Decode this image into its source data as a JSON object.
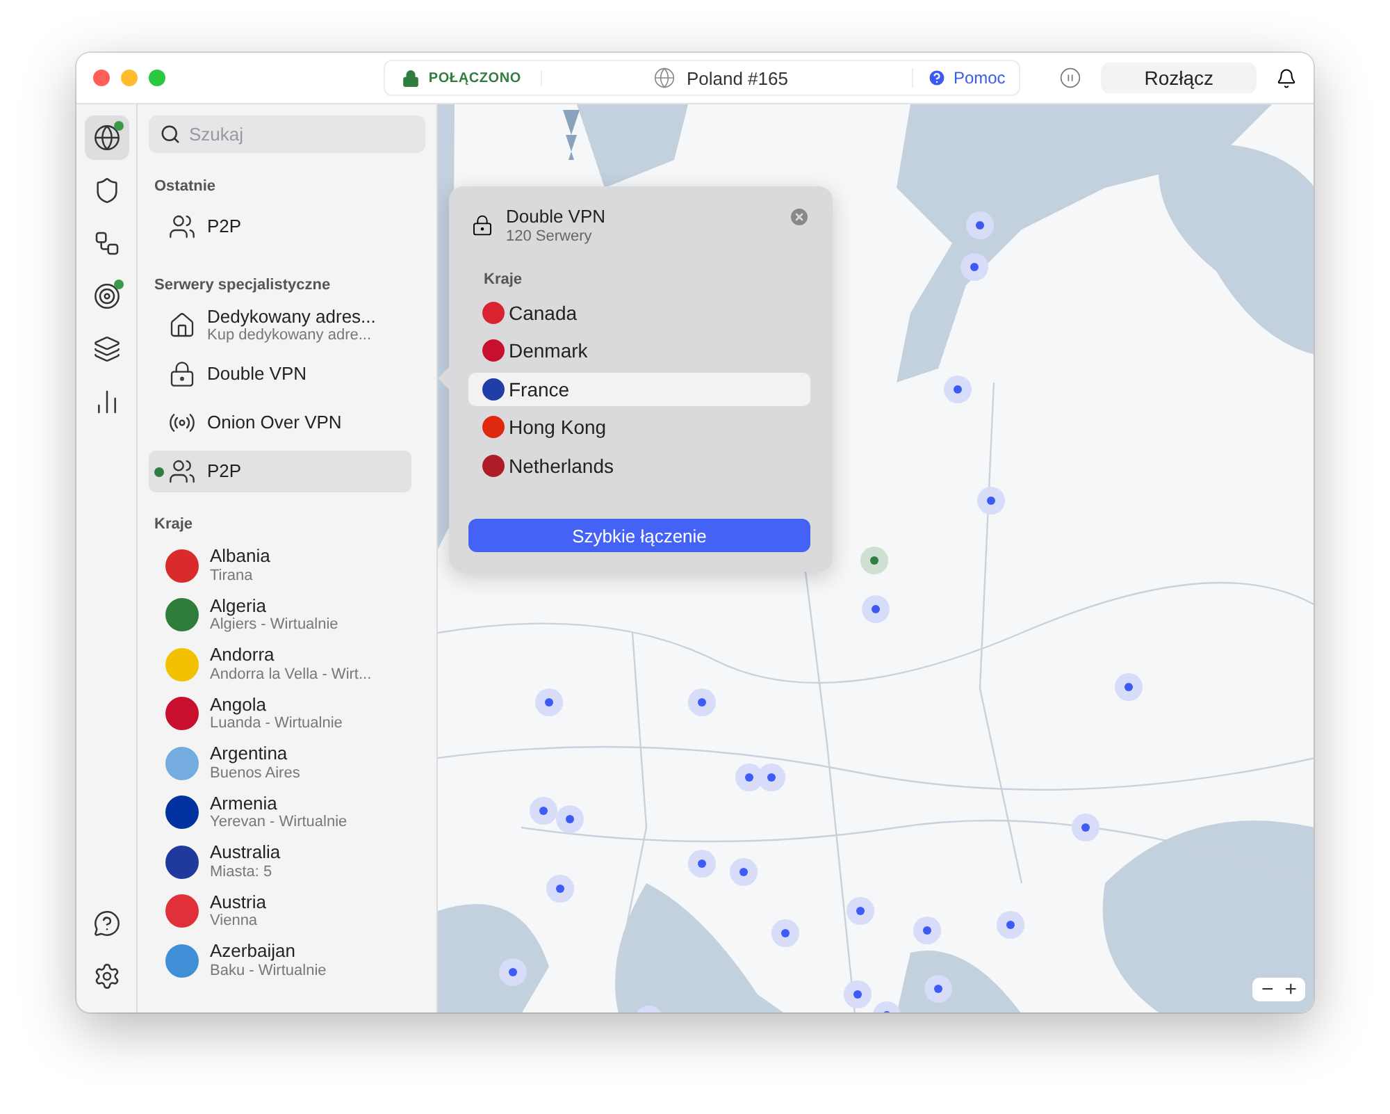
{
  "titlebar": {
    "status": "POŁĄCZONO",
    "server": "Poland #165",
    "help": "Pomoc",
    "disconnect": "Rozłącz"
  },
  "rail": [
    {
      "kind": "globe",
      "selected": true,
      "indicator": true
    },
    {
      "kind": "shield",
      "selected": false,
      "indicator": false
    },
    {
      "kind": "mesh",
      "selected": false,
      "indicator": false
    },
    {
      "kind": "target",
      "selected": false,
      "indicator": true
    },
    {
      "kind": "layers",
      "selected": false,
      "indicator": false
    },
    {
      "kind": "stats",
      "selected": false,
      "indicator": false
    }
  ],
  "rail_bottom": [
    {
      "kind": "support"
    },
    {
      "kind": "settings"
    }
  ],
  "search": {
    "placeholder": "Szukaj"
  },
  "recent": {
    "heading": "Ostatnie",
    "items": [
      {
        "kind": "p2p",
        "name": "P2P",
        "selected": false,
        "connected": false
      }
    ]
  },
  "specialty": {
    "heading": "Serwery specjalistyczne",
    "items": [
      {
        "kind": "dedicated",
        "name": "Dedykowany adres...",
        "detail": "Kup dedykowany adre...",
        "selected": false,
        "connected": false
      },
      {
        "kind": "double",
        "name": "Double VPN",
        "selected": false,
        "connected": false
      },
      {
        "kind": "onion",
        "name": "Onion Over VPN",
        "selected": false,
        "connected": false
      },
      {
        "kind": "p2p",
        "name": "P2P",
        "selected": true,
        "connected": true
      }
    ]
  },
  "countries": {
    "heading": "Kraje",
    "items": [
      {
        "name": "Albania",
        "detail": "Tirana",
        "color": "#d92b2b"
      },
      {
        "name": "Algeria",
        "detail": "Algiers - Wirtualnie",
        "color": "#2e7d3a"
      },
      {
        "name": "Andorra",
        "detail": "Andorra la Vella - Wirt...",
        "color": "#f2c200"
      },
      {
        "name": "Angola",
        "detail": "Luanda - Wirtualnie",
        "color": "#c8102e"
      },
      {
        "name": "Argentina",
        "detail": "Buenos Aires",
        "color": "#74acdf"
      },
      {
        "name": "Armenia",
        "detail": "Yerevan - Wirtualnie",
        "color": "#0033a0"
      },
      {
        "name": "Australia",
        "detail": "Miasta: 5",
        "color": "#1e3a9c"
      },
      {
        "name": "Austria",
        "detail": "Vienna",
        "color": "#e0313a"
      },
      {
        "name": "Azerbaijan",
        "detail": "Baku - Wirtualnie",
        "color": "#3f8fd6"
      }
    ]
  },
  "popover": {
    "title": "Double VPN",
    "subtitle": "120 Serwery",
    "heading": "Kraje",
    "items": [
      {
        "name": "Canada",
        "selected": false,
        "color": "#d9232e"
      },
      {
        "name": "Denmark",
        "selected": false,
        "color": "#c8102e"
      },
      {
        "name": "France",
        "selected": true,
        "color": "#1f3ea8"
      },
      {
        "name": "Hong Kong",
        "selected": false,
        "color": "#de2910"
      },
      {
        "name": "Netherlands",
        "selected": false,
        "color": "#ae1c28"
      }
    ],
    "button": "Szybkie łączenie"
  },
  "zoom": {
    "minus": "−",
    "plus": "+"
  }
}
